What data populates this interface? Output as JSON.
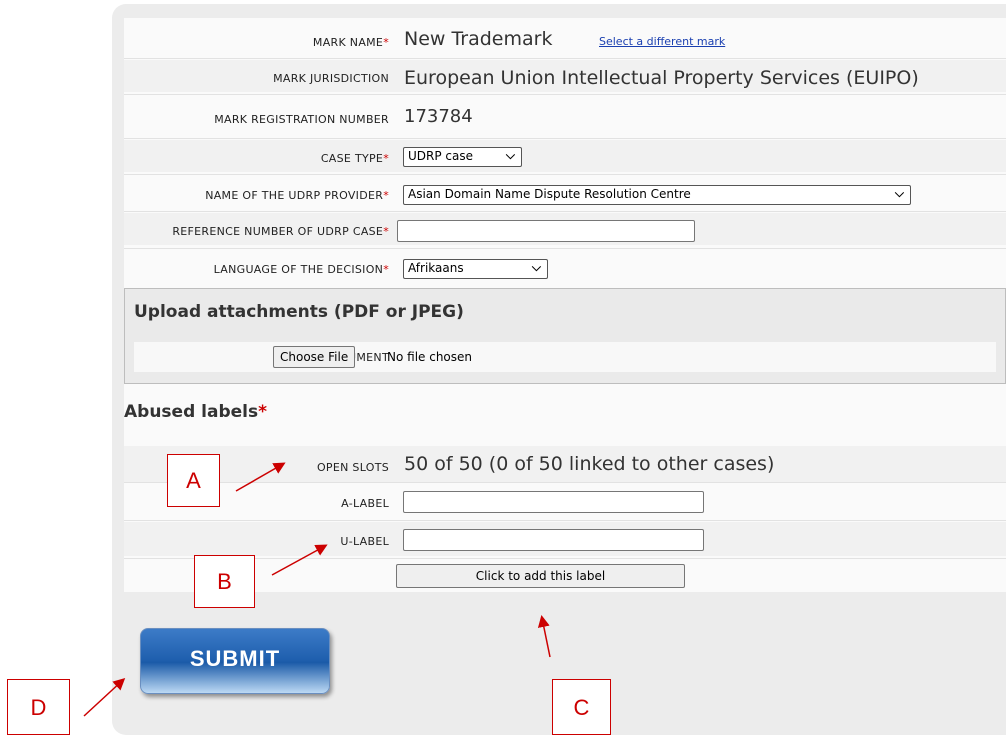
{
  "form": {
    "mark_name_label": "MARK NAME",
    "mark_name_value": "New Trademark",
    "select_mark_link": "Select a different mark",
    "jurisdiction_label": "MARK JURISDICTION",
    "jurisdiction_value": "European Union Intellectual Property Services (EUIPO)",
    "registration_label": "MARK REGISTRATION NUMBER",
    "registration_value": "173784",
    "case_type_label": "CASE TYPE",
    "case_type_value": "UDRP case",
    "provider_label": "NAME OF THE UDRP PROVIDER",
    "provider_value": "Asian Domain Name Dispute Resolution Centre",
    "reference_label": "REFERENCE NUMBER OF UDRP CASE",
    "reference_value": "",
    "language_label": "LANGUAGE OF THE DECISION",
    "language_value": "Afrikaans",
    "required_mark": "*"
  },
  "upload": {
    "title": "Upload attachments (PDF or JPEG)",
    "other_doc_label": "OTHER DOCUMENT",
    "choose_file_label": "Choose File",
    "no_file_text": "No file chosen"
  },
  "labels_section": {
    "title": "Abused labels",
    "open_slots_label": "OPEN SLOTS",
    "open_slots_value": "50 of 50 (0 of 50 linked to other cases)",
    "a_label": "A-LABEL",
    "a_label_value": "",
    "u_label": "U-LABEL",
    "u_label_value": "",
    "add_button": "Click to add this label"
  },
  "submit_label": "SUBMIT",
  "annotations": {
    "a": "A",
    "b": "B",
    "c": "C",
    "d": "D"
  },
  "colors": {
    "required": "#cc0000",
    "annotation": "#cc0000",
    "link": "#1a3fb0",
    "submit": "#1f5fae"
  }
}
